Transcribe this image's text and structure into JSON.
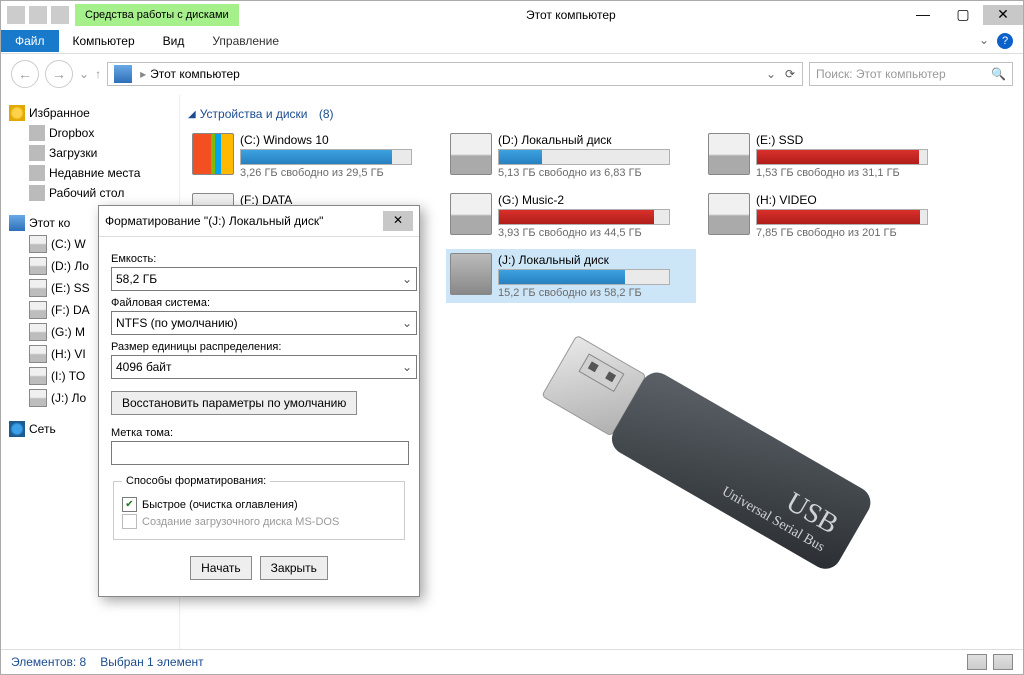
{
  "window": {
    "title": "Этот компьютер",
    "context_tab": "Средства работы с дисками"
  },
  "ribbon": {
    "file": "Файл",
    "computer": "Компьютер",
    "view": "Вид",
    "manage": "Управление"
  },
  "nav": {
    "breadcrumb": "Этот компьютер",
    "search_placeholder": "Поиск: Этот компьютер"
  },
  "sidebar": {
    "favorites": "Избранное",
    "fav_items": [
      "Dropbox",
      "Загрузки",
      "Недавние места",
      "Рабочий стол"
    ],
    "this_pc": "Этот ко",
    "pc_items": [
      "(C:) W",
      "(D:) Ло",
      "(E:) SS",
      "(F:) DA",
      "(G:) M",
      "(H:) VI",
      "(I:) TO",
      "(J:) Ло"
    ],
    "network": "Сеть"
  },
  "section": {
    "title_prefix": "Устройства и диски",
    "count": "(8)"
  },
  "drives": [
    {
      "name": "(C:) Windows 10",
      "free": "3,26 ГБ свободно из 29,5 ГБ",
      "fill": 89,
      "color": "blue",
      "icon": "win"
    },
    {
      "name": "(D:) Локальный диск",
      "free": "5,13 ГБ свободно из 6,83 ГБ",
      "fill": 25,
      "color": "blue",
      "icon": "hdd"
    },
    {
      "name": "(E:) SSD",
      "free": "1,53 ГБ свободно из 31,1 ГБ",
      "fill": 95,
      "color": "red",
      "icon": "hdd"
    },
    {
      "name": "(F:) DATA",
      "free": "",
      "fill": 0,
      "color": "blue",
      "icon": "hdd"
    },
    {
      "name": "(G:) Music-2",
      "free": "3,93 ГБ свободно из 44,5 ГБ",
      "fill": 91,
      "color": "red",
      "icon": "hdd"
    },
    {
      "name": "(H:) VIDEO",
      "free": "7,85 ГБ свободно из 201 ГБ",
      "fill": 96,
      "color": "red",
      "icon": "hdd"
    },
    {
      "name": "",
      "free": "",
      "fill": 0,
      "color": "",
      "icon": ""
    },
    {
      "name": "(J:) Локальный диск",
      "free": "15,2 ГБ свободно из 58,2 ГБ",
      "fill": 74,
      "color": "blue",
      "icon": "usb",
      "selected": true
    }
  ],
  "dialog": {
    "title": "Форматирование \"(J:) Локальный диск\"",
    "capacity_label": "Емкость:",
    "capacity_value": "58,2 ГБ",
    "fs_label": "Файловая система:",
    "fs_value": "NTFS (по умолчанию)",
    "alloc_label": "Размер единицы распределения:",
    "alloc_value": "4096 байт",
    "restore_btn": "Восстановить параметры по умолчанию",
    "volume_label": "Метка тома:",
    "group_label": "Способы форматирования:",
    "quick": "Быстрое (очистка оглавления)",
    "msdos": "Создание загрузочного диска MS-DOS",
    "start": "Начать",
    "close": "Закрыть"
  },
  "status": {
    "items": "Элементов: 8",
    "selected": "Выбран 1 элемент"
  },
  "usb": {
    "line1": "USB",
    "line2": "Universal Serial Bus"
  }
}
